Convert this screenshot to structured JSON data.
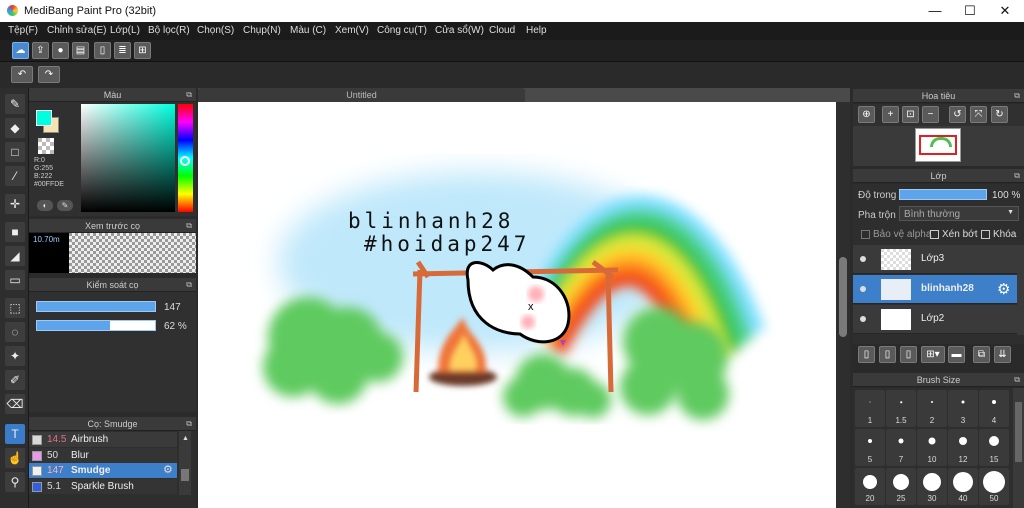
{
  "window": {
    "title": "MediBang Paint Pro (32bit)",
    "minimize": "—",
    "maximize": "☐",
    "close": "✕"
  },
  "menu": [
    "Tệp(F)",
    "Chỉnh sửa(E)",
    "Lớp(L)",
    "Bộ lọc(R)",
    "Chọn(S)",
    "Chụp(N)",
    "Màu (C)",
    "Xem(V)",
    "Công cụ(T)",
    "Cửa sổ(W)",
    "Cloud",
    "Help"
  ],
  "toolbar": {
    "undo": "↶",
    "redo": "↷"
  },
  "color_panel": {
    "title": "Màu",
    "r": "R:0",
    "g": "G:255",
    "b": "B:222",
    "hex": "#00FFDE",
    "main_color": "#00ffde",
    "sub_color": "#f6e4b0"
  },
  "brush_preview": {
    "title": "Xem trước cọ",
    "size": "10.70m"
  },
  "brush_control": {
    "title": "Kiểm soát cọ",
    "size_value": "147",
    "opacity_value": "62 %",
    "opacity_level": 0.62
  },
  "brush_list": {
    "title": "Cọ: Smudge",
    "items": [
      {
        "size": "14.5",
        "name": "Airbrush",
        "color": "#d8d8d8"
      },
      {
        "size": "50",
        "name": "Blur",
        "color": "#e89ae8"
      },
      {
        "size": "147",
        "name": "Smudge",
        "color": "#f0f0f0",
        "selected": true
      },
      {
        "size": "5.1",
        "name": "Sparkle Brush",
        "color": "#3060e0"
      }
    ]
  },
  "document": {
    "tab": "Untitled",
    "text_line1": "blinhanh28",
    "text_line2": "#hoidap247"
  },
  "navigator": {
    "title": "Hoa tiêu"
  },
  "layer_panel": {
    "title": "Lớp",
    "opacity_label": "Độ trong",
    "opacity_value": "100 %",
    "blend_label": "Pha trộn",
    "blend_value": "Bình thường",
    "alpha_protect": "Bảo vệ alpha",
    "clipping": "Xén bớt",
    "lock": "Khóa",
    "layers": [
      {
        "name": "Lớp3",
        "selected": false
      },
      {
        "name": "blinhanh28",
        "selected": true
      },
      {
        "name": "Lớp2",
        "selected": false
      }
    ]
  },
  "brush_size": {
    "title": "Brush Size",
    "sizes": [
      "1",
      "1.5",
      "2",
      "3",
      "4",
      "5",
      "7",
      "10",
      "12",
      "15",
      "20",
      "25",
      "30",
      "40",
      "50"
    ]
  }
}
